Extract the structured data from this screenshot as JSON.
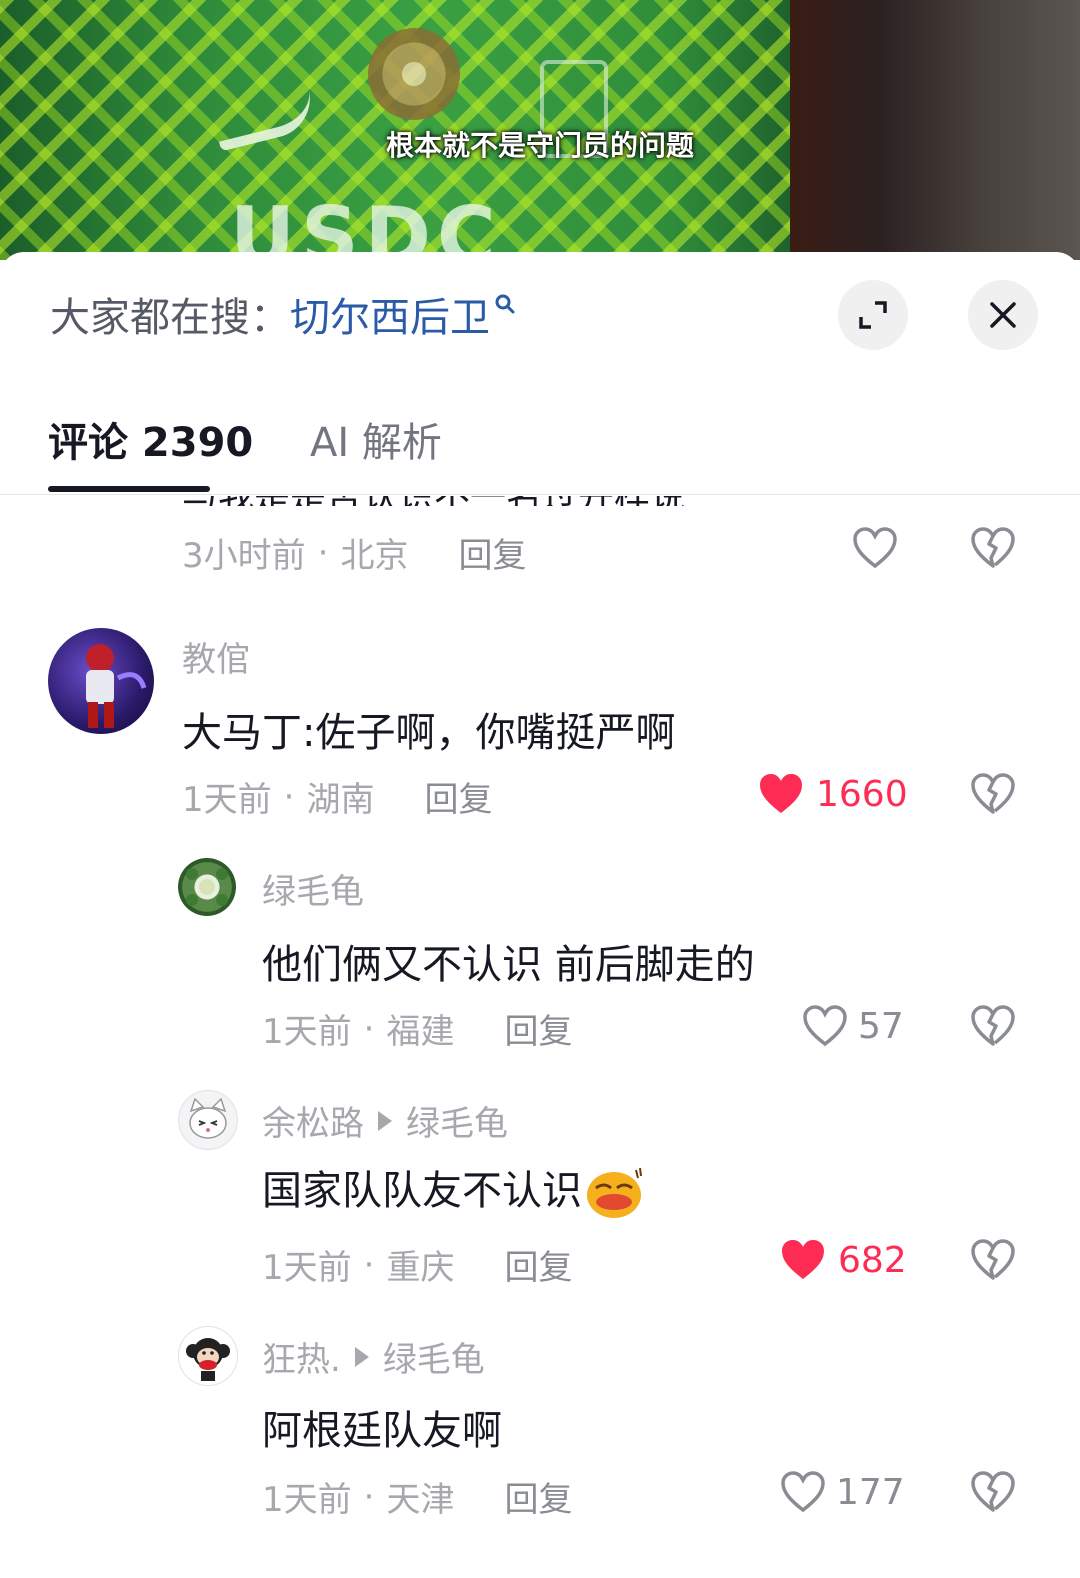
{
  "video": {
    "subtitle": "根本就不是守门员的问题"
  },
  "sheet": {
    "search_prefix": "大家都在搜：",
    "search_term": "切尔西后卫"
  },
  "tabs": [
    {
      "label": "评论 2390",
      "active": true
    },
    {
      "label": "AI 解析",
      "active": false
    }
  ],
  "comments": [
    {
      "clipped_text": "与我是是否认识不一名过开样说",
      "time": "3小时前",
      "location": "北京",
      "reply": "回复"
    },
    {
      "user": "教倌",
      "text": "大马丁:佐子啊，你嘴挺严啊",
      "time": "1天前",
      "location": "湖南",
      "reply": "回复",
      "likes": "1660",
      "liked": true
    },
    {
      "user": "绿毛龟",
      "text": "他们俩又不认识 前后脚走的",
      "time": "1天前",
      "location": "福建",
      "reply": "回复",
      "likes": "57",
      "liked": false
    },
    {
      "user": "余松路",
      "reply_to": "绿毛龟",
      "text": "国家队队友不认识",
      "emoji": "smirk-emoji",
      "time": "1天前",
      "location": "重庆",
      "reply": "回复",
      "likes": "682",
      "liked": true
    },
    {
      "user": "狂热.",
      "reply_to": "绿毛龟",
      "text": "阿根廷队友啊",
      "time": "1天前",
      "location": "天津",
      "reply": "回复",
      "likes": "177",
      "liked": false
    }
  ],
  "colors": {
    "like_red": "#fe2c55",
    "search_blue": "#2a5aa8",
    "meta_grey": "#a6a8ae"
  }
}
